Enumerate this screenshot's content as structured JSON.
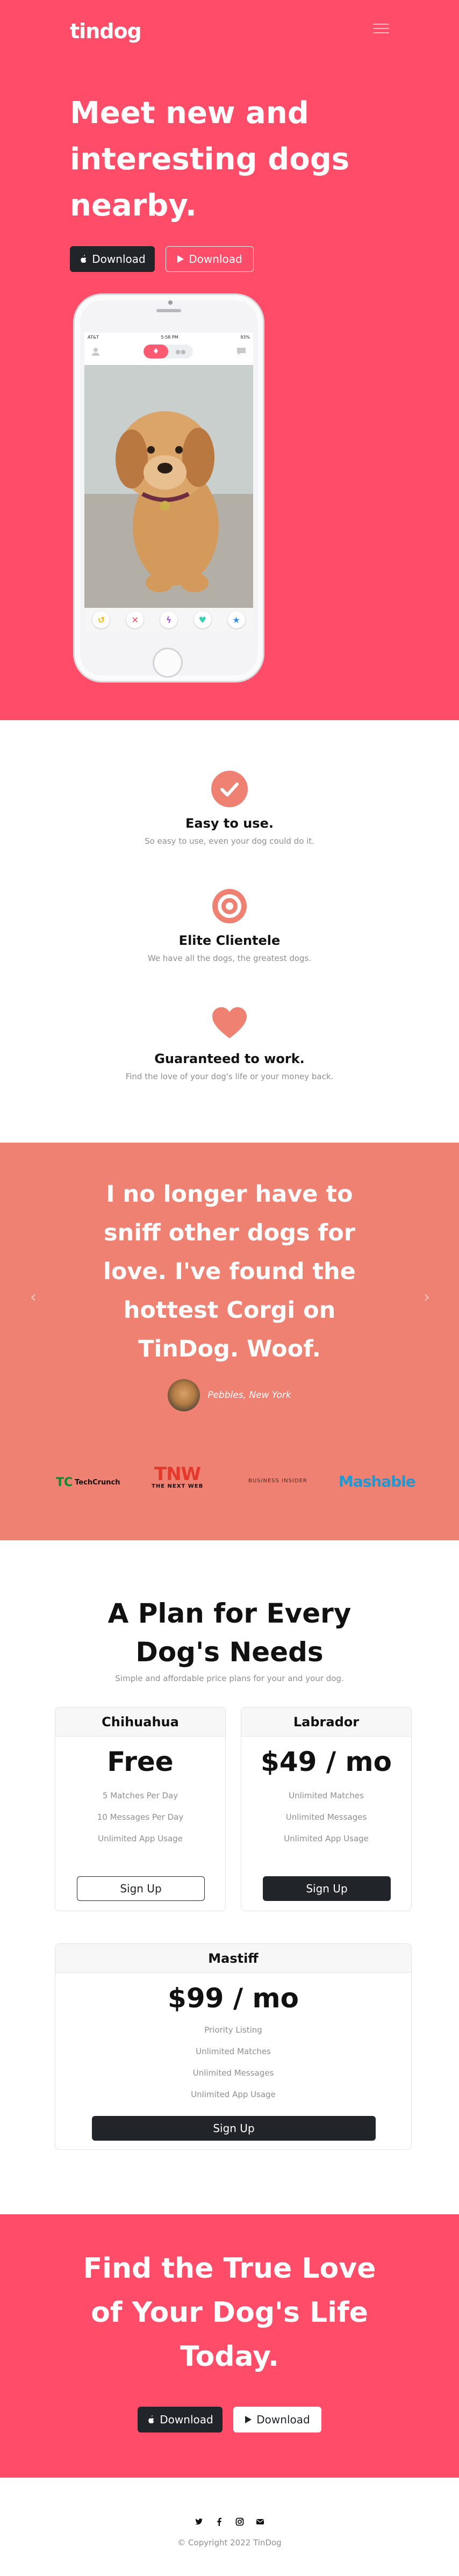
{
  "brand": "tindog",
  "hero": {
    "title": "Meet new and interesting dogs nearby.",
    "download_dark": "Download",
    "download_outline": "Download"
  },
  "phone": {
    "carrier": "AT&T",
    "time": "5:58 PM",
    "battery": "93%"
  },
  "features": [
    {
      "icon": "check-circle-icon",
      "title": "Easy to use.",
      "text": "So easy to use, even your dog could do it."
    },
    {
      "icon": "bullseye-icon",
      "title": "Elite Clientele",
      "text": "We have all the dogs, the greatest dogs."
    },
    {
      "icon": "heart-icon",
      "title": "Guaranteed to work.",
      "text": "Find the love of your dog's life or your money back."
    }
  ],
  "testimonial": {
    "quote": "I no longer have to sniff other dogs for love. I've found the hottest Corgi on TinDog. Woof.",
    "author": "Pebbles, New York"
  },
  "press": [
    "TechCrunch",
    "TNW",
    "THE NEXT WEB",
    "BUSINESS INSIDER",
    "Mashable"
  ],
  "pricing": {
    "title": "A Plan for Every Dog's Needs",
    "subtitle": "Simple and affordable price plans for your and your dog.",
    "plans": [
      {
        "name": "Chihuahua",
        "price": "Free",
        "features": [
          "5 Matches Per Day",
          "10 Messages Per Day",
          "Unlimited App Usage"
        ],
        "button": "Sign Up"
      },
      {
        "name": "Labrador",
        "price": "$49 / mo",
        "features": [
          "Unlimited Matches",
          "Unlimited Messages",
          "Unlimited App Usage"
        ],
        "button": "Sign Up"
      },
      {
        "name": "Mastiff",
        "price": "$99 / mo",
        "features": [
          "Priority Listing",
          "Unlimited Matches",
          "Unlimited Messages",
          "Unlimited App Usage"
        ],
        "button": "Sign Up"
      }
    ]
  },
  "cta": {
    "title": "Find the True Love of Your Dog's Life Today.",
    "download_dark": "Download",
    "download_light": "Download"
  },
  "footer": {
    "copyright": "© Copyright 2022 TinDog"
  },
  "colors": {
    "primary": "#ff4c68",
    "secondary": "#ef8172",
    "dark": "#212529"
  }
}
